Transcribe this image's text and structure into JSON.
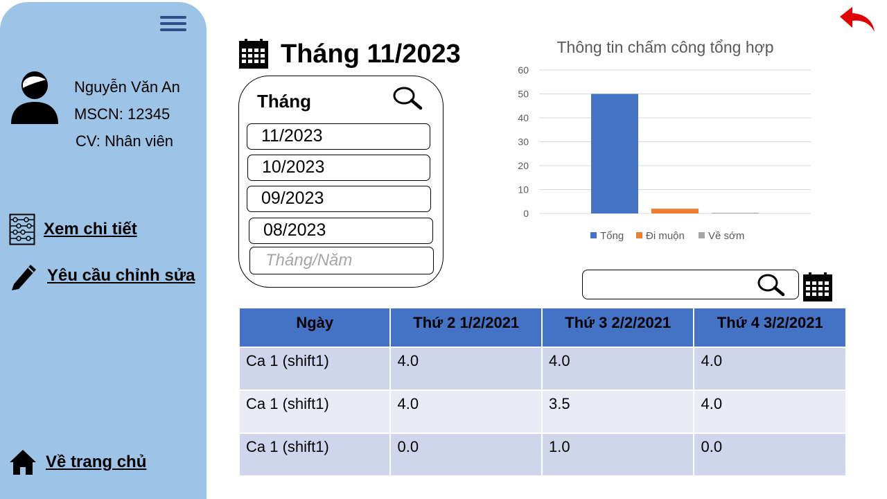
{
  "user": {
    "name": "Nguyễn Văn An",
    "id_text": "MSCN: 12345",
    "role_text": "CV: Nhân viên"
  },
  "nav": {
    "details": "Xem chi tiết",
    "edit_request": "Yêu cầu chỉnh sửa",
    "home": "Về trang chủ"
  },
  "header": {
    "title": "Tháng 11/2023"
  },
  "month_panel": {
    "label": "Tháng",
    "months": [
      "11/2023",
      "10/2023",
      "09/2023",
      "08/2023"
    ],
    "input_placeholder": "Tháng/Năm"
  },
  "search": {
    "value": "",
    "placeholder": ""
  },
  "table": {
    "headers": [
      "Ngày",
      "Thứ 2 1/2/2021",
      "Thứ 3 2/2/2021",
      "Thứ 4 3/2/2021"
    ],
    "rows": [
      [
        "Ca 1 (shift1)",
        "4.0",
        "4.0",
        "4.0"
      ],
      [
        "Ca 1 (shift1)",
        "4.0",
        "3.5",
        "4.0"
      ],
      [
        "Ca 1 (shift1)",
        "0.0",
        "1.0",
        "0.0"
      ]
    ]
  },
  "colors": {
    "sidebar": "#9dc3e6",
    "table_header": "#4472c4",
    "row_odd": "#cfd5ea",
    "row_even": "#e9ebf5",
    "back_arrow": "#e00000"
  },
  "chart_data": {
    "type": "bar",
    "title": "Thông tin chấm công tổng hợp",
    "categories": [
      ""
    ],
    "series": [
      {
        "name": "Tổng",
        "values": [
          50
        ],
        "color": "#4472c4"
      },
      {
        "name": "Đi muộn",
        "values": [
          2
        ],
        "color": "#ed7d31"
      },
      {
        "name": "Về sớm",
        "values": [
          0.3
        ],
        "color": "#a5a5a5"
      }
    ],
    "yticks": [
      "0",
      "10",
      "20",
      "30",
      "40",
      "50",
      "60"
    ],
    "ylim": [
      0,
      60
    ],
    "grid": true,
    "legend": "bottom"
  }
}
